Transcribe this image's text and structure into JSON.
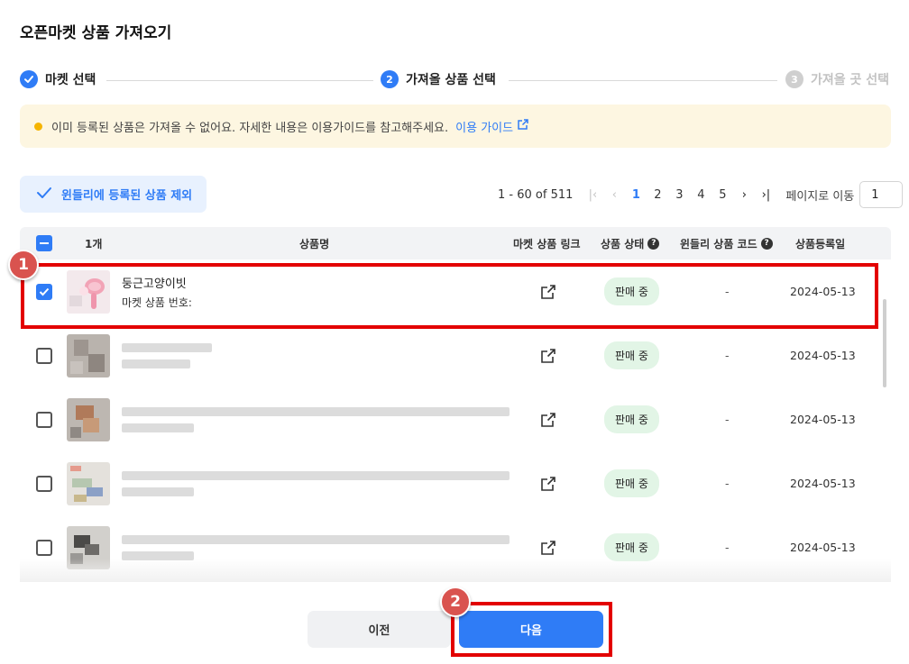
{
  "dialog": {
    "title": "오픈마켓 상품 가져오기"
  },
  "stepper": {
    "steps": [
      {
        "label": "마켓 선택",
        "num": "✓",
        "state": "done"
      },
      {
        "label": "가져올 상품 선택",
        "num": "2",
        "state": "active"
      },
      {
        "label": "가져올 곳 선택",
        "num": "3",
        "state": "pending"
      }
    ]
  },
  "notice": {
    "text": "이미 등록된 상품은 가져올 수 없어요. 자세한 내용은 이용가이드를 참고해주세요.",
    "link": "이용 가이드",
    "dot_color": "#f5b400"
  },
  "filter": {
    "label": "윈들리에 등록된 상품 제외"
  },
  "pagination": {
    "range": "1 - 60 of 511",
    "pages": [
      "1",
      "2",
      "3",
      "4",
      "5"
    ],
    "current": "1",
    "goto_label": "페이지로 이동",
    "goto_value": "1"
  },
  "table": {
    "headers": {
      "count": "1개",
      "name": "상품명",
      "link": "마켓 상품 링크",
      "status": "상품 상태",
      "code": "윈들리 상품 코드",
      "date": "상품등록일"
    },
    "rows": [
      {
        "checked": true,
        "name": "둥근고양이빗",
        "sub": "마켓 상품 번호:",
        "status": "판매 중",
        "code": "-",
        "date": "2024-05-13"
      },
      {
        "checked": false,
        "name": "",
        "sub": "",
        "status": "판매 중",
        "code": "-",
        "date": "2024-05-13"
      },
      {
        "checked": false,
        "name": "",
        "sub": "",
        "status": "판매 중",
        "code": "-",
        "date": "2024-05-13"
      },
      {
        "checked": false,
        "name": "",
        "sub": "",
        "status": "판매 중",
        "code": "-",
        "date": "2024-05-13"
      },
      {
        "checked": false,
        "name": "",
        "sub": "",
        "status": "판매 중",
        "code": "-",
        "date": "2024-05-13"
      }
    ]
  },
  "annotations": {
    "marker1": "1",
    "marker2": "2"
  },
  "footer": {
    "prev_label": "이전",
    "next_label": "다음"
  },
  "colors": {
    "accent": "#2f7cf6",
    "highlight": "#e30000",
    "badge_bg": "#e2f5e6"
  }
}
